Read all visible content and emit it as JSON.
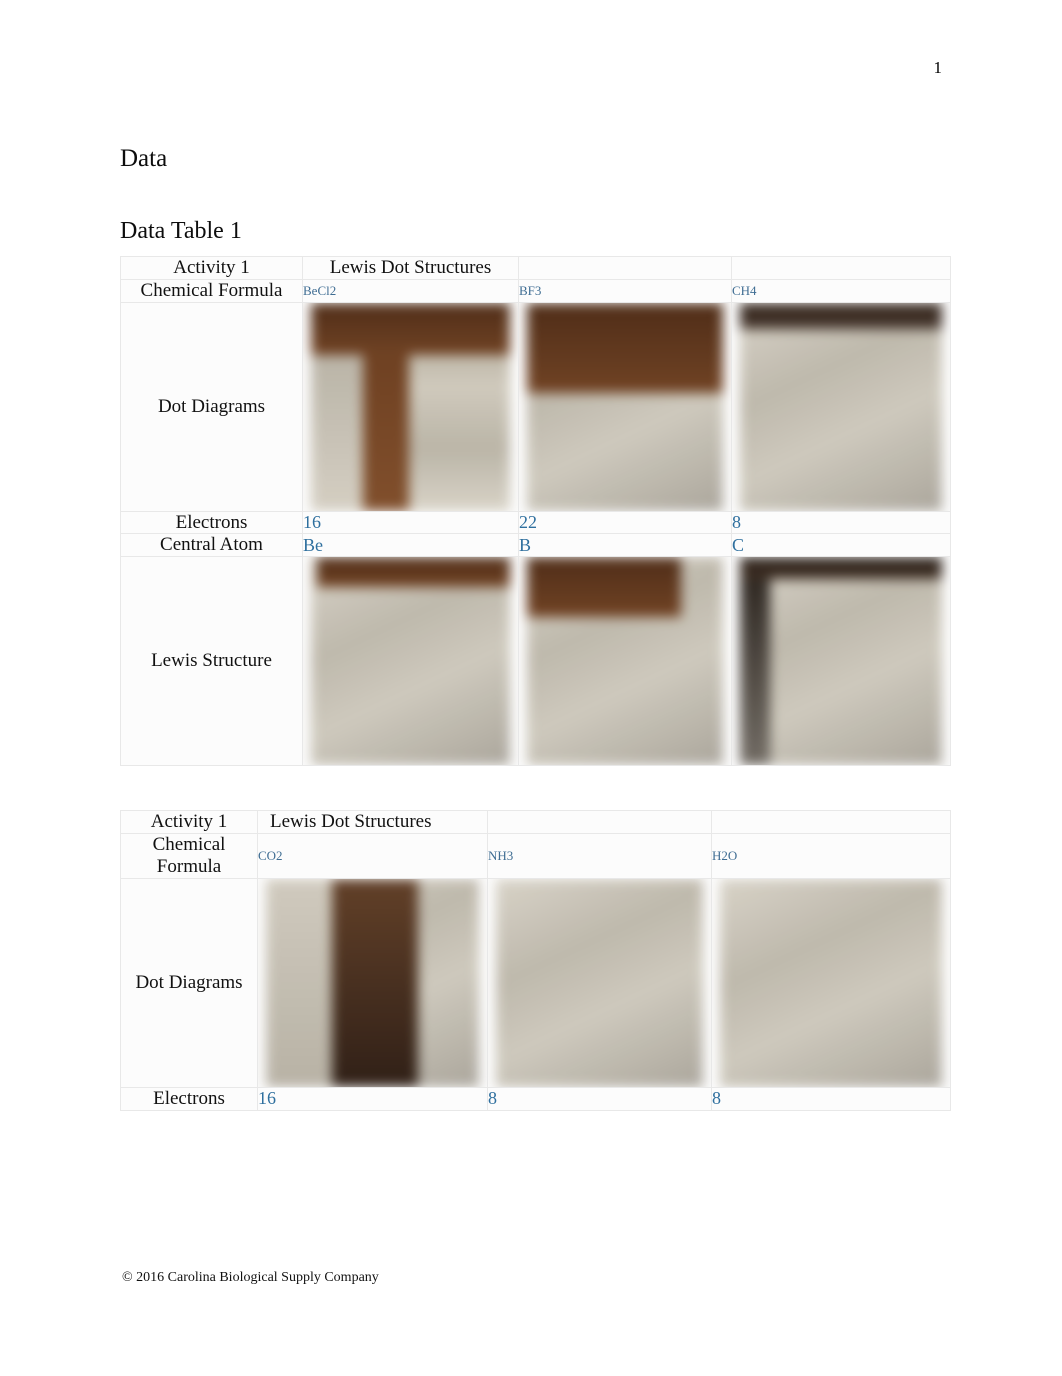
{
  "page": {
    "number": "1",
    "section_title": "Data",
    "table_title": "Data Table 1",
    "footer": "© 2016 Carolina Biological Supply Company"
  },
  "table1": {
    "header": {
      "activity": "Activity 1",
      "lewis_dot_structures": "Lewis Dot Structures"
    },
    "row_labels": {
      "chemical_formula": "Chemical Formula",
      "dot_diagrams": "Dot Diagrams",
      "electrons": "Electrons",
      "central_atom": "Central Atom",
      "lewis_structure": "Lewis Structure"
    },
    "columns": [
      {
        "formula": "BeCl2",
        "electrons": "16",
        "central_atom": "Be",
        "dot_diagram_image": "blurred-photo",
        "lewis_structure_image": "blurred-photo"
      },
      {
        "formula": "BF3",
        "electrons": "22",
        "central_atom": "B",
        "dot_diagram_image": "blurred-photo",
        "lewis_structure_image": "blurred-photo"
      },
      {
        "formula": "CH4",
        "electrons": "8",
        "central_atom": "C",
        "dot_diagram_image": "blurred-photo",
        "lewis_structure_image": "blurred-photo"
      }
    ]
  },
  "table2": {
    "header": {
      "activity": "Activity 1",
      "lewis_dot_structures": "Lewis Dot Structures"
    },
    "row_labels": {
      "chemical_formula": "Chemical Formula",
      "dot_diagrams": "Dot Diagrams",
      "electrons": "Electrons"
    },
    "columns": [
      {
        "formula": "CO2",
        "electrons": "16",
        "dot_diagram_image": "blurred-photo"
      },
      {
        "formula": "NH3",
        "electrons": "8",
        "dot_diagram_image": "blurred-photo"
      },
      {
        "formula": "H2O",
        "electrons": "8",
        "dot_diagram_image": "blurred-photo"
      }
    ]
  }
}
